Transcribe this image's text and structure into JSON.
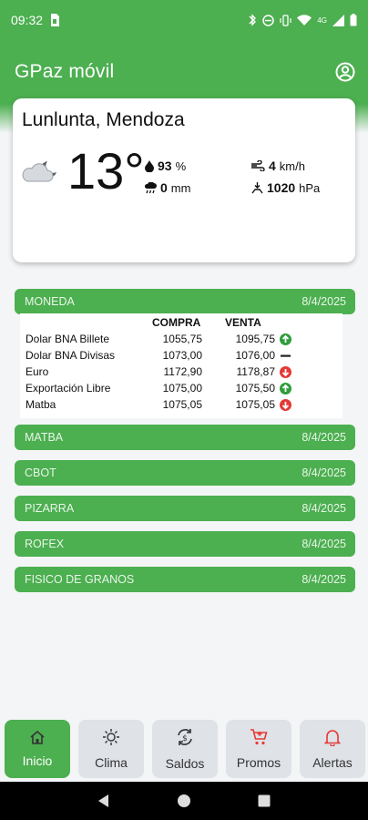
{
  "status_bar": {
    "time": "09:32",
    "icons": [
      "sim-card-icon",
      "bluetooth-icon",
      "do-not-disturb-icon",
      "vibrate-icon",
      "wifi-icon",
      "signal-icon",
      "battery-icon"
    ],
    "network_label": "4G"
  },
  "app_bar": {
    "title": "GPaz móvil",
    "profile_icon": "account-circle-icon"
  },
  "weather": {
    "city": "Lunlunta, Mendoza",
    "temperature": "13°",
    "humidity_value": "93",
    "humidity_unit": "%",
    "rain_value": "0",
    "rain_unit": "mm",
    "wind_value": "4",
    "wind_unit": "km/h",
    "pressure_value": "1020",
    "pressure_unit": "hPa",
    "icon": "cloudy-night-icon"
  },
  "moneda": {
    "title": "MONEDA",
    "date": "8/4/2025",
    "col_compra": "COMPRA",
    "col_venta": "VENTA",
    "rows": [
      {
        "name": "Dolar BNA Billete",
        "compra": "1055,75",
        "venta": "1095,75",
        "trend": "up"
      },
      {
        "name": "Dolar BNA Divisas",
        "compra": "1073,00",
        "venta": "1076,00",
        "trend": "flat"
      },
      {
        "name": "Euro",
        "compra": "1172,90",
        "venta": "1178,87",
        "trend": "down"
      },
      {
        "name": "Exportación Libre",
        "compra": "1075,00",
        "venta": "1075,50",
        "trend": "up"
      },
      {
        "name": "Matba",
        "compra": "1075,05",
        "venta": "1075,05",
        "trend": "down"
      }
    ]
  },
  "sections": [
    {
      "title": "MATBA",
      "date": "8/4/2025"
    },
    {
      "title": "CBOT",
      "date": "8/4/2025"
    },
    {
      "title": "PIZARRA",
      "date": "8/4/2025"
    },
    {
      "title": "ROFEX",
      "date": "8/4/2025"
    },
    {
      "title": "FISICO DE GRANOS",
      "date": "8/4/2025"
    }
  ],
  "bottom_nav": {
    "items": [
      {
        "label": "Inicio",
        "icon": "home-icon",
        "active": true
      },
      {
        "label": "Clima",
        "icon": "sun-icon",
        "active": false
      },
      {
        "label": "Saldos",
        "icon": "currency-exchange-icon",
        "active": false
      },
      {
        "label": "Promos",
        "icon": "cart-icon",
        "active": false
      },
      {
        "label": "Alertas",
        "icon": "bell-icon",
        "active": false
      }
    ]
  },
  "colors": {
    "primary": "#4caf50",
    "up": "#2e9e3a",
    "down": "#e53935",
    "flat": "#222222",
    "alert_icon": "#e53935"
  }
}
